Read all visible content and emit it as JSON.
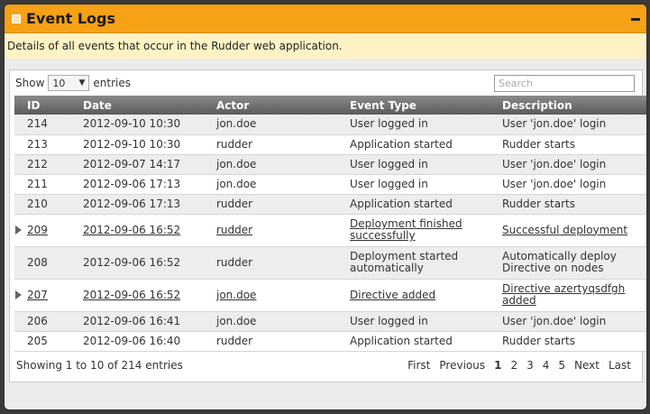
{
  "panel": {
    "title": "Event Logs",
    "description": "Details of all events that occur in the Rudder web application."
  },
  "table_controls": {
    "show_label": "Show",
    "entries_value": "10",
    "entries_label": "entries",
    "search_placeholder": "Search"
  },
  "columns": [
    "ID",
    "Date",
    "Actor",
    "Event Type",
    "Description"
  ],
  "rows": [
    {
      "id": "214",
      "date": "2012-09-10 10:30",
      "actor": "jon.doe",
      "type": "User logged in",
      "desc": "User 'jon.doe' login",
      "expandable": false
    },
    {
      "id": "213",
      "date": "2012-09-10 10:30",
      "actor": "rudder",
      "type": "Application started",
      "desc": "Rudder starts",
      "expandable": false
    },
    {
      "id": "212",
      "date": "2012-09-07 14:17",
      "actor": "jon.doe",
      "type": "User logged in",
      "desc": "User 'jon.doe' login",
      "expandable": false
    },
    {
      "id": "211",
      "date": "2012-09-06 17:13",
      "actor": "jon.doe",
      "type": "User logged in",
      "desc": "User 'jon.doe' login",
      "expandable": false
    },
    {
      "id": "210",
      "date": "2012-09-06 17:13",
      "actor": "rudder",
      "type": "Application started",
      "desc": "Rudder starts",
      "expandable": false
    },
    {
      "id": "209",
      "date": "2012-09-06 16:52",
      "actor": "rudder",
      "type": "Deployment finished successfully",
      "desc": "Successful deployment",
      "expandable": true
    },
    {
      "id": "208",
      "date": "2012-09-06 16:52",
      "actor": "rudder",
      "type": "Deployment started automatically",
      "desc": "Automatically deploy Directive on nodes",
      "expandable": false
    },
    {
      "id": "207",
      "date": "2012-09-06 16:52",
      "actor": "jon.doe",
      "type": "Directive added",
      "desc": "Directive azertyqsdfgh added",
      "expandable": true
    },
    {
      "id": "206",
      "date": "2012-09-06 16:41",
      "actor": "jon.doe",
      "type": "User logged in",
      "desc": "User 'jon.doe' login",
      "expandable": false
    },
    {
      "id": "205",
      "date": "2012-09-06 16:40",
      "actor": "rudder",
      "type": "Application started",
      "desc": "Rudder starts",
      "expandable": false
    }
  ],
  "footer": {
    "info": "Showing 1 to 10 of 214 entries",
    "first": "First",
    "previous": "Previous",
    "pages": [
      "1",
      "2",
      "3",
      "4",
      "5"
    ],
    "next": "Next",
    "last": "Last",
    "active_page": "1"
  },
  "colors": {
    "header_orange": "#f6a116",
    "description_bar": "#fff3c5",
    "table_header_dark": "#5b5b5b"
  },
  "icons": {
    "expand": "triangle-right-icon",
    "collapse": "minus-icon"
  }
}
